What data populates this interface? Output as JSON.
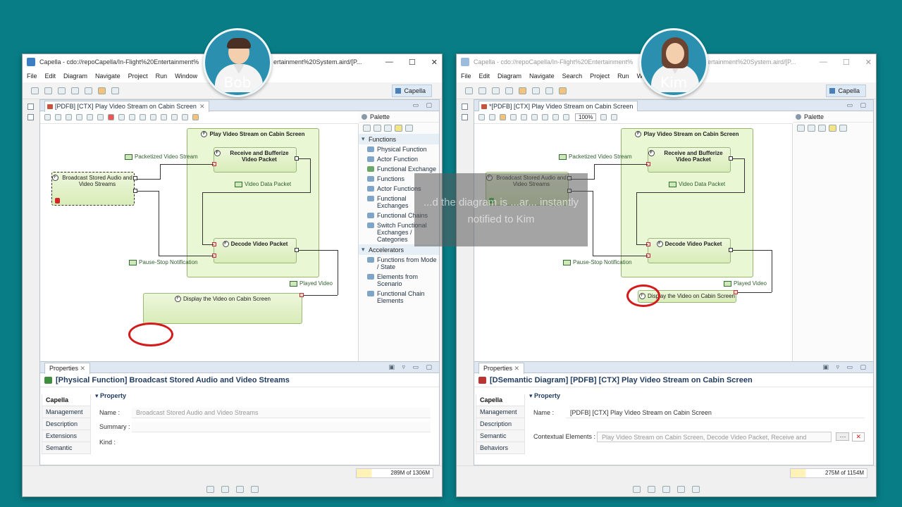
{
  "bob": {
    "title": "Capella - cdo://repoCapella/In-Flight%20Entertainment%",
    "title_tail": "ertainment%20System.aird/[P...",
    "menu": [
      "File",
      "Edit",
      "Diagram",
      "Navigate",
      "Project",
      "Run",
      "Window"
    ],
    "perspective": "Capella",
    "editor_tab": "[PDFB] [CTX] Play Video Stream on Cabin Screen",
    "properties_tab": "Properties",
    "properties_title": "[Physical Function] Broadcast Stored Audio and Video Streams",
    "property_section": "Property",
    "side_tabs": [
      "Capella",
      "Management",
      "Description",
      "Extensions",
      "Semantic"
    ],
    "fields": [
      {
        "label": "Name :",
        "value": "Broadcast Stored Audio and Video Streams"
      },
      {
        "label": "Summary :",
        "value": ""
      },
      {
        "label": "Kind :",
        "value": ""
      }
    ],
    "memory": "289M of 1306M",
    "avatar_name": "Bob"
  },
  "kim": {
    "title": "Capella - cdo://repoCapella/In-Flight%20Entertainment%",
    "title_tail": "ertainment%20System.aird/[P...",
    "menu": [
      "File",
      "Edit",
      "Diagram",
      "Navigate",
      "Search",
      "Project",
      "Run",
      "Wi"
    ],
    "perspective": "Capella",
    "editor_tab": "*[PDFB] [CTX] Play Video Stream on Cabin Screen",
    "zoom": "100%",
    "properties_tab": "Properties",
    "properties_title": "[DSemantic Diagram] [PDFB] [CTX] Play Video Stream on Cabin Screen",
    "property_section": "Property",
    "side_tabs": [
      "Capella",
      "Management",
      "Description",
      "Semantic",
      "Behaviors"
    ],
    "fields": [
      {
        "label": "Name :",
        "value": "[PDFB] [CTX] Play Video Stream on Cabin Screen"
      },
      {
        "label": "Contextual Elements :",
        "value": "Play Video Stream on Cabin Screen, Decode Video Packet, Receive and"
      }
    ],
    "memory": "275M of 1154M",
    "avatar_name": "Kim"
  },
  "palette": {
    "title": "Palette",
    "sections": [
      {
        "name": "Functions",
        "items": [
          "Physical Function",
          "Actor Function",
          "Functional Exchange",
          "Functions",
          "Actor Functions",
          "Functional Exchanges",
          "Functional Chains",
          "Switch Functional Exchanges / Categories"
        ]
      },
      {
        "name": "Accelerators",
        "items": [
          "Functions from Mode / State",
          "Elements from Scenario",
          "Functional Chain Elements"
        ]
      }
    ]
  },
  "diagram": {
    "container": "Play Video Stream on Cabin Screen",
    "receive": "Receive and Bufferize Video Packet",
    "decode": "Decode Video Packet",
    "broadcast": "Broadcast Stored Audio and Video Streams",
    "display": "Display the Video on Cabin Screen",
    "exchanges": {
      "packetized": "Packetized Video Stream",
      "video_data": "Video Data Packet",
      "pause_stop": "Pause-Stop Notification",
      "played": "Played Video"
    }
  },
  "overlay_text": "...d the diagram is ...ar... instantly notified to Kim",
  "colors": {
    "background": "#087d86",
    "function_fill": "#d8ecb8",
    "highlight_circle": "#d31b1b",
    "avatar_bg": "#2b8fb0"
  }
}
